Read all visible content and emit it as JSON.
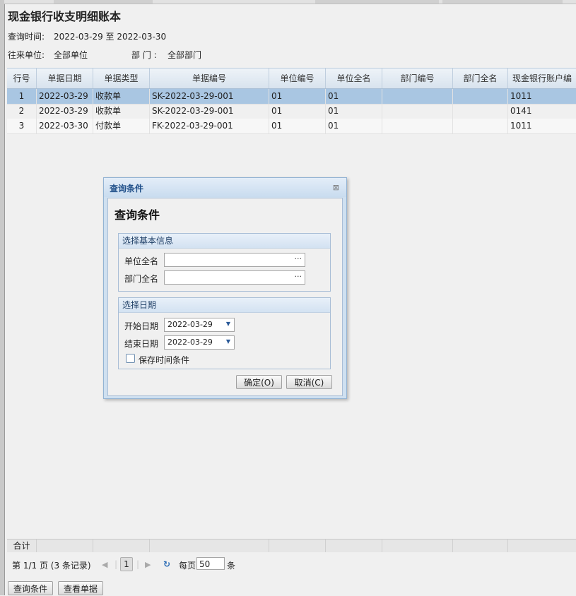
{
  "page": {
    "title": "现金银行收支明细账本",
    "query_time_label": "查询时间:",
    "query_time_value": "2022-03-29 至 2022-03-30",
    "unit_label": "往来单位:",
    "unit_value": "全部单位",
    "dept_label": "部 门 :",
    "dept_value": "全部部门"
  },
  "table": {
    "headers": [
      "行号",
      "单据日期",
      "单据类型",
      "单据编号",
      "单位编号",
      "单位全名",
      "部门编号",
      "部门全名",
      "现金银行账户编"
    ],
    "rows": [
      [
        "1",
        "2022-03-29",
        "收款单",
        "SK-2022-03-29-001",
        "01",
        "01",
        "",
        "",
        "1011"
      ],
      [
        "2",
        "2022-03-29",
        "收款单",
        "SK-2022-03-29-001",
        "01",
        "01",
        "",
        "",
        "0141"
      ],
      [
        "3",
        "2022-03-30",
        "付款单",
        "FK-2022-03-29-001",
        "01",
        "01",
        "",
        "",
        "1011"
      ]
    ],
    "sum_label": "合计"
  },
  "pager": {
    "page_info": "第 1/1 页 (3 条记录)",
    "current_page": "1",
    "per_page_label": "每页",
    "per_page_value": "50",
    "per_page_unit": "条"
  },
  "buttons": {
    "query": "查询条件",
    "view_doc": "查看单据"
  },
  "dialog": {
    "title": "查询条件",
    "heading": "查询条件",
    "basic_info_section": "选择基本信息",
    "unit_name_label": "单位全名",
    "unit_name_value": "",
    "dept_name_label": "部门全名",
    "dept_name_value": "",
    "date_section": "选择日期",
    "start_date_label": "开始日期",
    "start_date_value": "2022-03-29",
    "end_date_label": "结束日期",
    "end_date_value": "2022-03-29",
    "save_time_label": "保存时间条件",
    "save_time_checked": false,
    "ok_label": "确定(O)",
    "cancel_label": "取消(C)"
  }
}
